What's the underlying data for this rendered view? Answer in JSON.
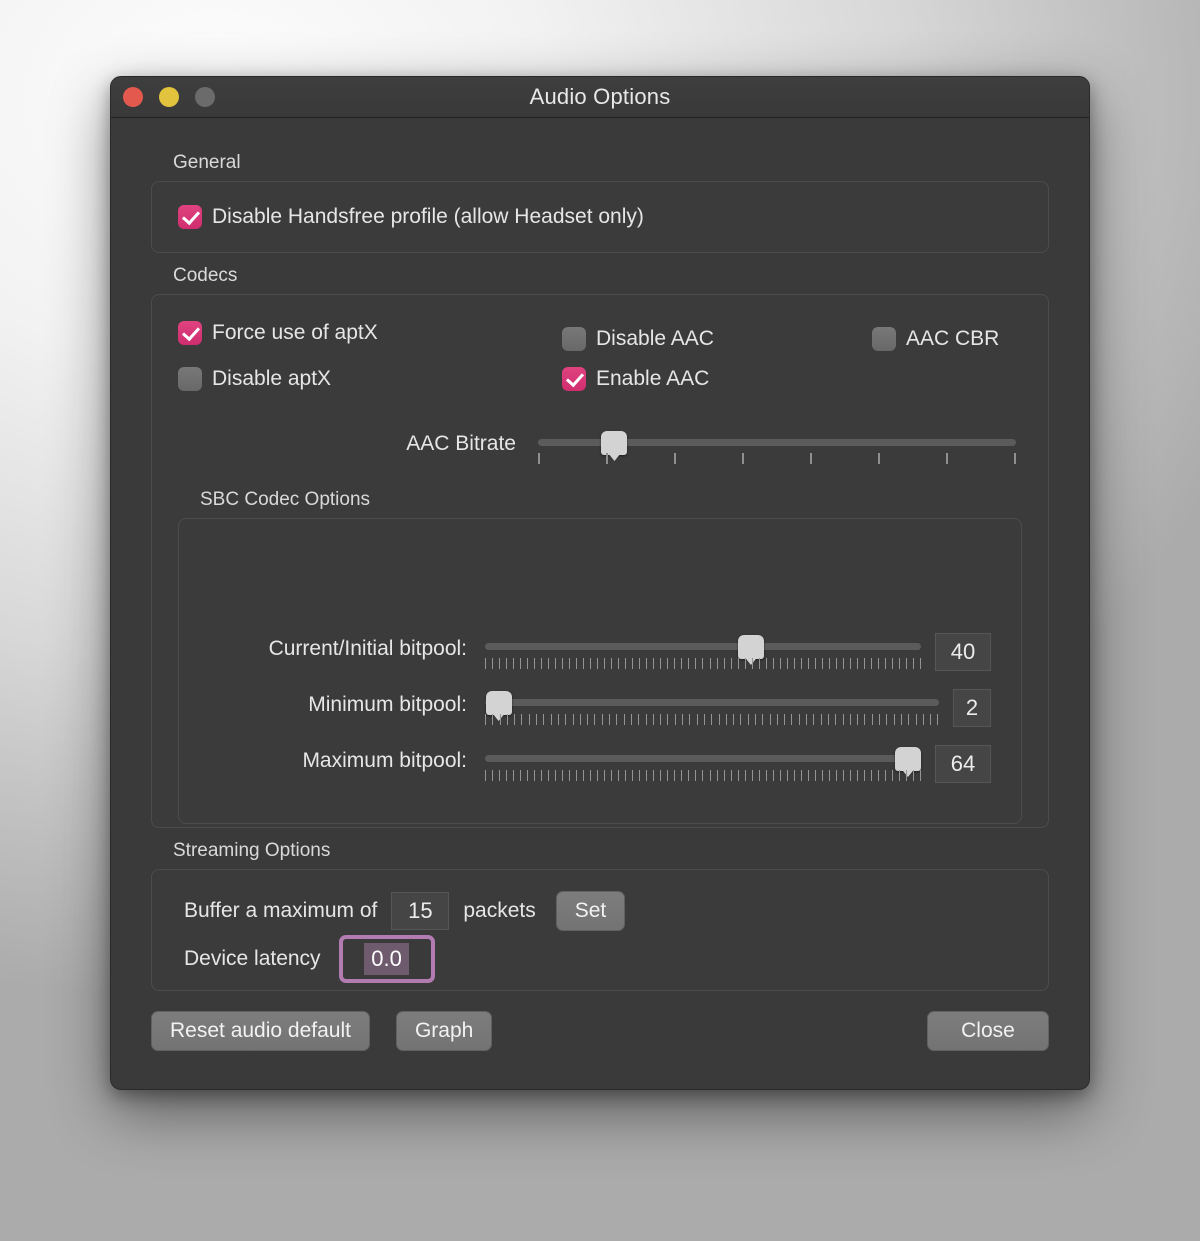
{
  "window": {
    "title": "Audio Options",
    "traffic_lights": [
      {
        "name": "close",
        "color": "#e3594d"
      },
      {
        "name": "minimize",
        "color": "#e1c33d"
      },
      {
        "name": "zoom",
        "color": "#6b6b6b"
      }
    ]
  },
  "general": {
    "label": "General",
    "disable_handsfree": {
      "label": "Disable Handsfree profile (allow Headset only)",
      "checked": true
    }
  },
  "codecs": {
    "label": "Codecs",
    "force_aptx": {
      "label": "Force use of aptX",
      "checked": true
    },
    "disable_aptx": {
      "label": "Disable aptX",
      "checked": false
    },
    "disable_aac": {
      "label": "Disable AAC",
      "checked": false
    },
    "enable_aac": {
      "label": "Enable AAC",
      "checked": true
    },
    "aac_cbr": {
      "label": "AAC CBR",
      "checked": false
    },
    "aac_bitrate": {
      "label": "AAC Bitrate",
      "position_percent": 16,
      "tick_count": 8
    }
  },
  "sbc": {
    "label": "SBC Codec Options",
    "rows": [
      {
        "label": "Current/Initial bitpool:",
        "value": "40",
        "position_percent": 61
      },
      {
        "label": "Minimum bitpool:",
        "value": "2",
        "position_percent": 3
      },
      {
        "label": "Maximum bitpool:",
        "value": "64",
        "position_percent": 97
      }
    ]
  },
  "streaming": {
    "label": "Streaming Options",
    "buffer_prefix": "Buffer a maximum of",
    "buffer_value": "15",
    "buffer_suffix": "packets",
    "set_label": "Set",
    "latency_label": "Device latency",
    "latency_value": "0.0"
  },
  "footer": {
    "reset_label": "Reset audio default",
    "graph_label": "Graph",
    "close_label": "Close"
  }
}
